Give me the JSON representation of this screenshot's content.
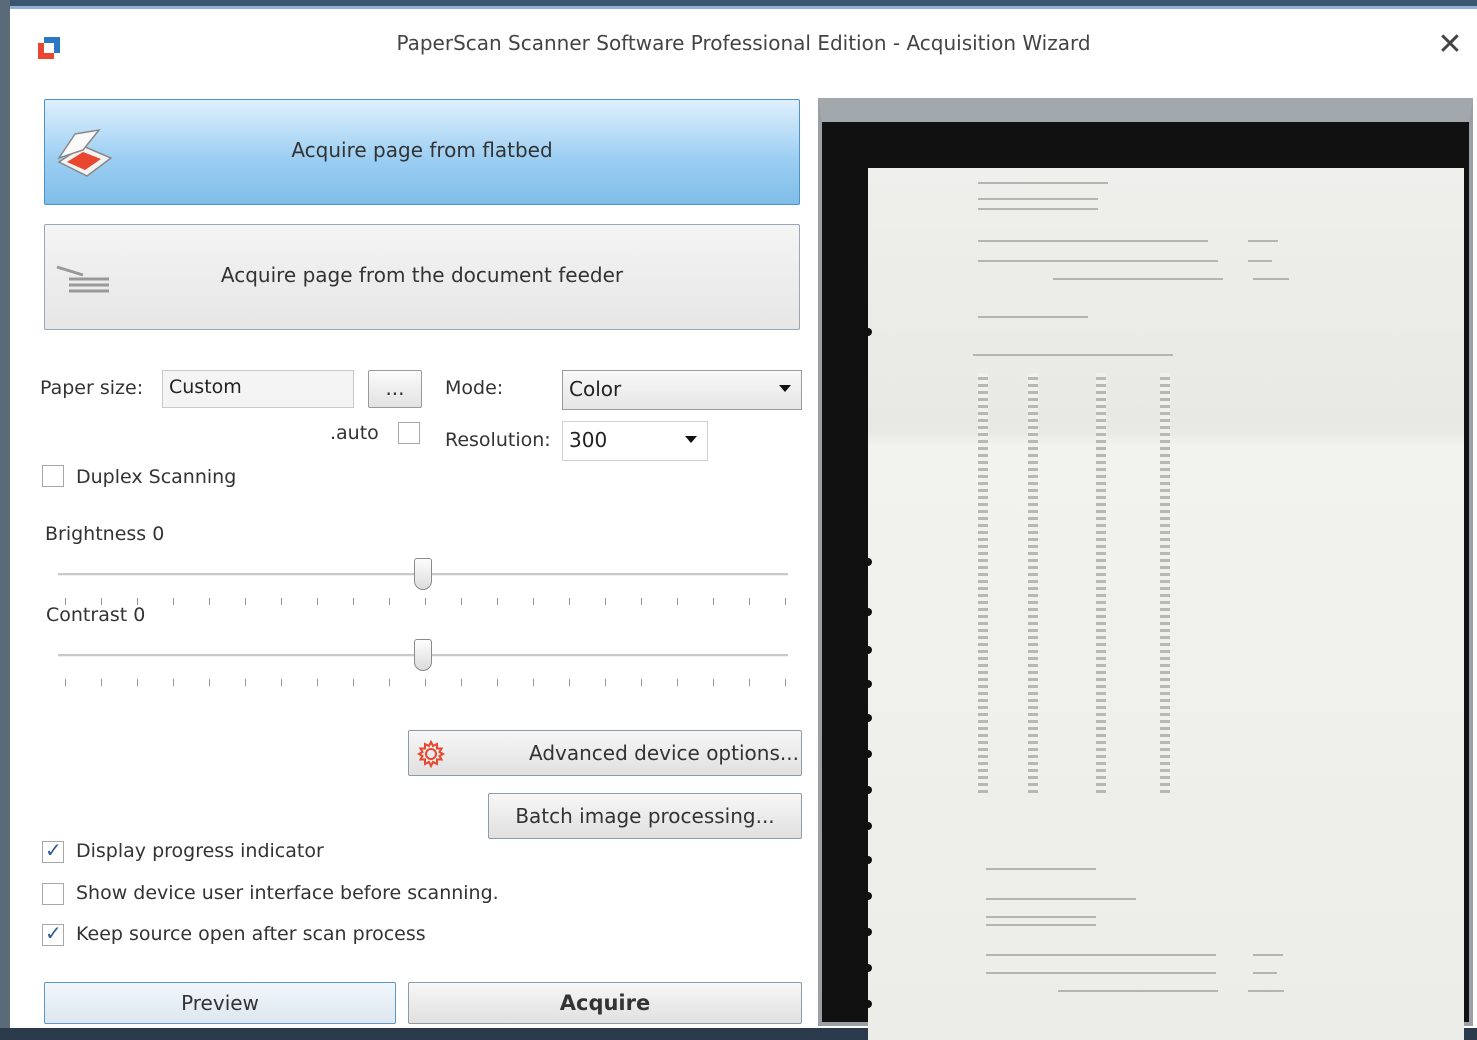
{
  "window": {
    "title": "PaperScan Scanner Software Professional Edition - Acquisition Wizard",
    "close_label": "✕"
  },
  "acquire_flatbed": {
    "label": "Acquire page from flatbed"
  },
  "acquire_feeder": {
    "label": "Acquire page from the document feeder"
  },
  "paper_size": {
    "label": "Paper size:",
    "value": "Custom",
    "browse_label": "...",
    "auto_label": ".auto",
    "auto_checked": false
  },
  "mode": {
    "label": "Mode:",
    "value": "Color"
  },
  "resolution": {
    "label": "Resolution:",
    "value": "300"
  },
  "duplex": {
    "label": "Duplex Scanning",
    "checked": false
  },
  "brightness": {
    "label": "Brightness 0",
    "value": 0,
    "min": -100,
    "max": 100
  },
  "contrast": {
    "label": "Contrast 0",
    "value": 0,
    "min": -100,
    "max": 100
  },
  "advanced_button": {
    "label": "Advanced device options..."
  },
  "batch_button": {
    "label": "Batch image processing..."
  },
  "options": [
    {
      "label": "Display progress indicator",
      "checked": true
    },
    {
      "label": "Show device user interface before scanning.",
      "checked": false
    },
    {
      "label": "Keep source open after scan process",
      "checked": true
    }
  ],
  "preview_button": {
    "label": "Preview"
  },
  "acquire_button": {
    "label": "Acquire"
  },
  "icons": {
    "app": "paperscan-logo-icon",
    "flatbed": "flatbed-scanner-icon",
    "feeder": "document-feeder-icon",
    "advanced": "gear-icon"
  },
  "colors": {
    "accent": "#7fbde8",
    "gear": "#e8462e"
  }
}
